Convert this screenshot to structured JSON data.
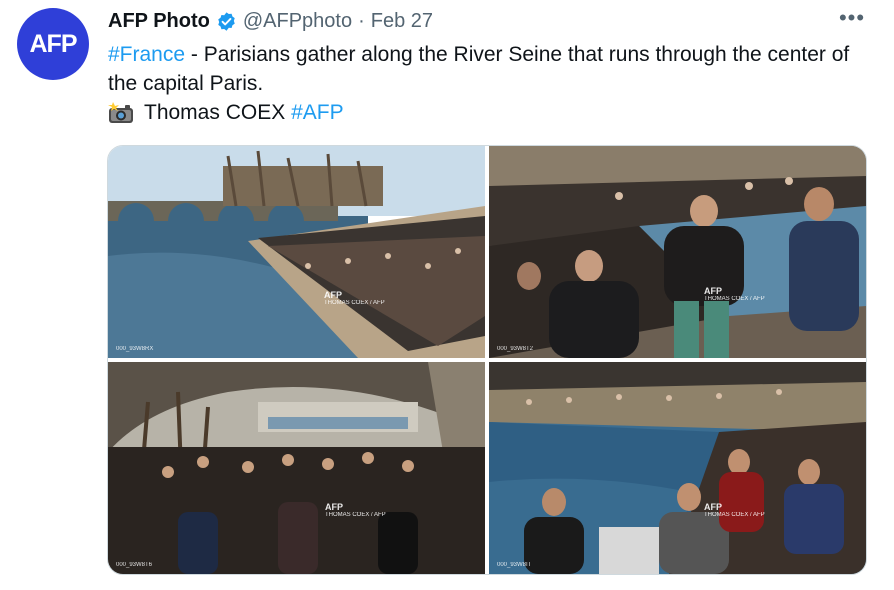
{
  "author": {
    "name": "AFP Photo",
    "handle": "@AFPphoto",
    "separator": "·",
    "date": "Feb 27",
    "avatar_text": "AFP",
    "verified_icon": "verified-badge-icon",
    "brand_color": "#2f3fd8"
  },
  "more_label": "•••",
  "body": {
    "hashtag_france": "#France",
    "text_line": " - Parisians gather along the River Seine that runs through the center of the capital Paris.",
    "camera_icon": "camera-flash-icon",
    "photographer": "Thomas COEX",
    "hashtag_afp": "#AFP"
  },
  "colors": {
    "link": "#1d9bf0",
    "secondary_text": "#536471"
  },
  "photos": [
    {
      "logo": "AFP",
      "credit": "THOMAS COEX / AFP",
      "id": "000_93W8RX"
    },
    {
      "logo": "AFP",
      "credit": "THOMAS COEX / AFP",
      "id": "000_93W8T2"
    },
    {
      "logo": "AFP",
      "credit": "THOMAS COEX / AFP",
      "id": "000_93W8T6"
    },
    {
      "logo": "AFP",
      "credit": "THOMAS COEX / AFP",
      "id": "000_93W8IT"
    }
  ]
}
